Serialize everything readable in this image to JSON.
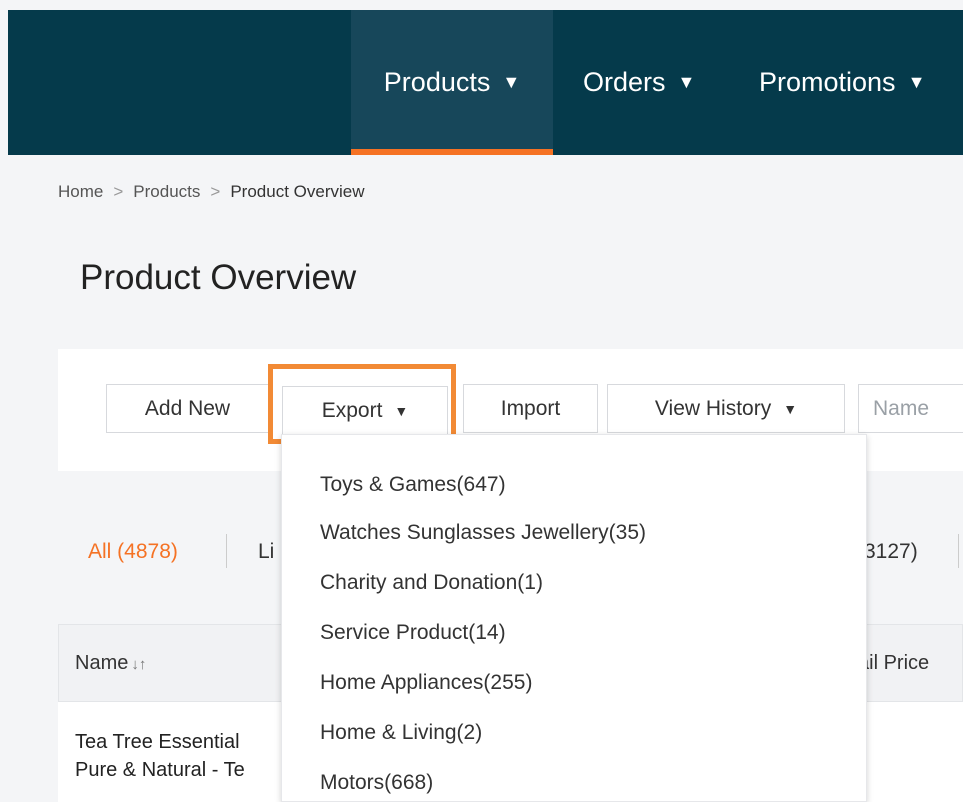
{
  "nav": {
    "items": [
      {
        "label": "Products"
      },
      {
        "label": "Orders"
      },
      {
        "label": "Promotions"
      }
    ],
    "caret": "▼"
  },
  "breadcrumb": {
    "items": [
      "Home",
      "Products",
      "Product Overview"
    ],
    "separator": ">"
  },
  "page": {
    "title": "Product Overview"
  },
  "toolbar": {
    "add_new": "Add New",
    "export": "Export",
    "import": "Import",
    "view_history": "View History",
    "name_placeholder": "Name"
  },
  "status_tabs": {
    "all": "All (4878)",
    "live_partial": "Li",
    "other_partial": "3127)"
  },
  "table": {
    "headers": {
      "name": "Name",
      "sort_icon": "↓↑",
      "price_partial": "ail Price"
    },
    "rows": [
      {
        "name_line1": "Tea Tree Essential",
        "name_line2": "Pure & Natural - Te"
      }
    ]
  },
  "export_menu": {
    "items": [
      "Toys & Games(647)",
      "Watches Sunglasses Jewellery(35)",
      "Charity and Donation(1)",
      "Service Product(14)",
      "Home Appliances(255)",
      "Home & Living(2)",
      "Motors(668)"
    ]
  },
  "colors": {
    "topbar": "#053a4b",
    "accent": "#f57224",
    "highlight_box": "#f28a35"
  },
  "icons": {
    "dropdown": "caret-down-icon",
    "sort": "sort-icon"
  }
}
